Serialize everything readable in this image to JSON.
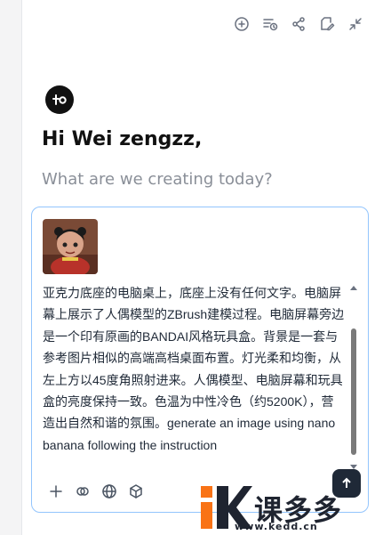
{
  "toolbar": {
    "icons": [
      "add-chat-icon",
      "history-icon",
      "share-icon",
      "edit-icon",
      "collapse-icon"
    ]
  },
  "header": {
    "greeting": "Hi Wei zengzz,",
    "subtitle": "What are we creating today?"
  },
  "composer": {
    "attachment": "reference-image",
    "prompt": "亚克力底座的电脑桌上，底座上没有任何文字。电脑屏幕上展示了人偶模型的ZBrush建模过程。电脑屏幕旁边是一个印有原画的BANDAI风格玩具盒。背景是一套与参考图片相似的高端高档桌面布置。灯光柔和均衡，从左上方以45度角照射进来。人偶模型、电脑屏幕和玩具盒的亮度保持一致。色温为中性冷色（约5200K），营造出自然和谐的氛围。generate an image using nano banana following the instruction",
    "tools": [
      "add-icon",
      "link-icon",
      "globe-icon",
      "cube-icon"
    ]
  },
  "watermark": {
    "name": "课多多",
    "url": "www.kedd.cn"
  },
  "colors": {
    "accent_border": "#93c5fd",
    "brand_orange": "#f97316",
    "text_primary": "#111111",
    "text_muted": "#8a8f98"
  }
}
